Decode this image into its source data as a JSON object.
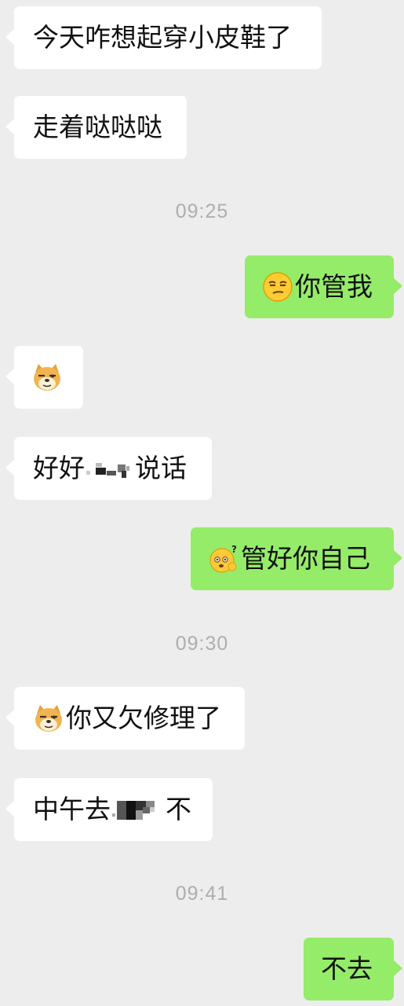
{
  "messages": [
    {
      "type": "received",
      "text": "今天咋想起穿小皮鞋了"
    },
    {
      "type": "received",
      "text": "走着哒哒哒"
    },
    {
      "type": "time",
      "text": "09:25"
    },
    {
      "type": "sent",
      "emoji": "smirk-face-icon",
      "text": "你管我"
    },
    {
      "type": "received",
      "emoji": "doge-icon",
      "text": ""
    },
    {
      "type": "received",
      "text_before": "好好",
      "redacted": true,
      "text_after": "说话"
    },
    {
      "type": "sent",
      "emoji": "confused-question-face-icon",
      "text": "管好你自己"
    },
    {
      "type": "time",
      "text": "09:30"
    },
    {
      "type": "received",
      "emoji": "doge-icon",
      "text": "你又欠修理了"
    },
    {
      "type": "received",
      "text_before": "中午去",
      "redacted": true,
      "text_after": "不"
    },
    {
      "type": "time",
      "text": "09:41"
    },
    {
      "type": "sent",
      "text": "不去"
    }
  ],
  "colors": {
    "background": "#ededed",
    "received_bubble": "#ffffff",
    "sent_bubble": "#95ec69",
    "timestamp": "#aeaeae"
  }
}
